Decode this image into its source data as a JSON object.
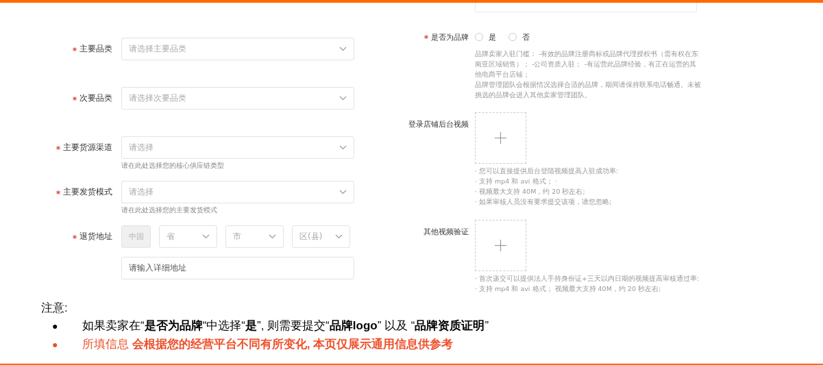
{
  "left_form": [
    {
      "kind": "select",
      "label": "主要品类",
      "required": true,
      "placeholder": "请选择主要品类"
    },
    {
      "kind": "select",
      "label": "次要品类",
      "required": true,
      "placeholder": "请选择次要品类"
    },
    {
      "kind": "select",
      "label": "主要货源渠道",
      "required": true,
      "placeholder": "请选择",
      "hint": "请在此处选择您的核心供应链类型"
    },
    {
      "kind": "select",
      "label": "主要发货模式",
      "required": true,
      "placeholder": "请选择",
      "hint": "请在此处选择您的主要发货模式"
    },
    {
      "kind": "address",
      "label": "退货地址",
      "required": true,
      "country": {
        "value": "中国",
        "disabled": true
      },
      "selects": [
        {
          "placeholder": "省"
        },
        {
          "placeholder": "市"
        },
        {
          "placeholder": "区(县)"
        }
      ],
      "detail_placeholder": "请输入详细地址"
    }
  ],
  "right_form": {
    "brand": {
      "label": "是否为品牌",
      "required": true,
      "options": [
        {
          "label": "是",
          "selected": false
        },
        {
          "label": "否",
          "selected": false
        }
      ],
      "description": [
        "品牌卖家入驻门槛： -有效的品牌注册商标或品牌代理授权书（需有权在东南亚区域销售）； -公司资质入驻； -有运营此品牌经验，有正在运营的其他电商平台店铺；",
        "品牌管理团队会根据情况选择合适的品牌，期间请保持联系电话畅通。未被挑选的品牌会进入其他卖家管理团队。"
      ]
    },
    "uploads": [
      {
        "label": "登录店铺后台视频",
        "hints": [
          "· 您可以直接提供后台登陆视频提高入驻成功率:",
          "· 支持 mp4 和 avi 格式； ·",
          "· 视频最大支持 40M，约 20 秒左右;",
          "· 如果审核人员没有要求提交该项，请您忽略;"
        ]
      },
      {
        "label": "其他视频验证",
        "hints": [
          "· 首次递交可以提供法人手持身份证+三天以内日期的视频提高审核通过率:",
          "· 支持 mp4 和 avi 格式； 视频最大支持 40M，约 20 秒左右;"
        ]
      }
    ]
  },
  "notes": {
    "title": "注意:",
    "items": [
      {
        "bullet": "●",
        "text": "如果卖家在“**是否为品牌**“中选择“**是**”, 则需要提交“**品牌logo**” 以及 “**品牌资质证明**”",
        "color": "#000000"
      },
      {
        "bullet": "●",
        "text": "所填信息 **会根据您的经营平台不同有所变化, 本页仅展示通用信息供参考**",
        "color": "#ee4f2a"
      }
    ]
  }
}
